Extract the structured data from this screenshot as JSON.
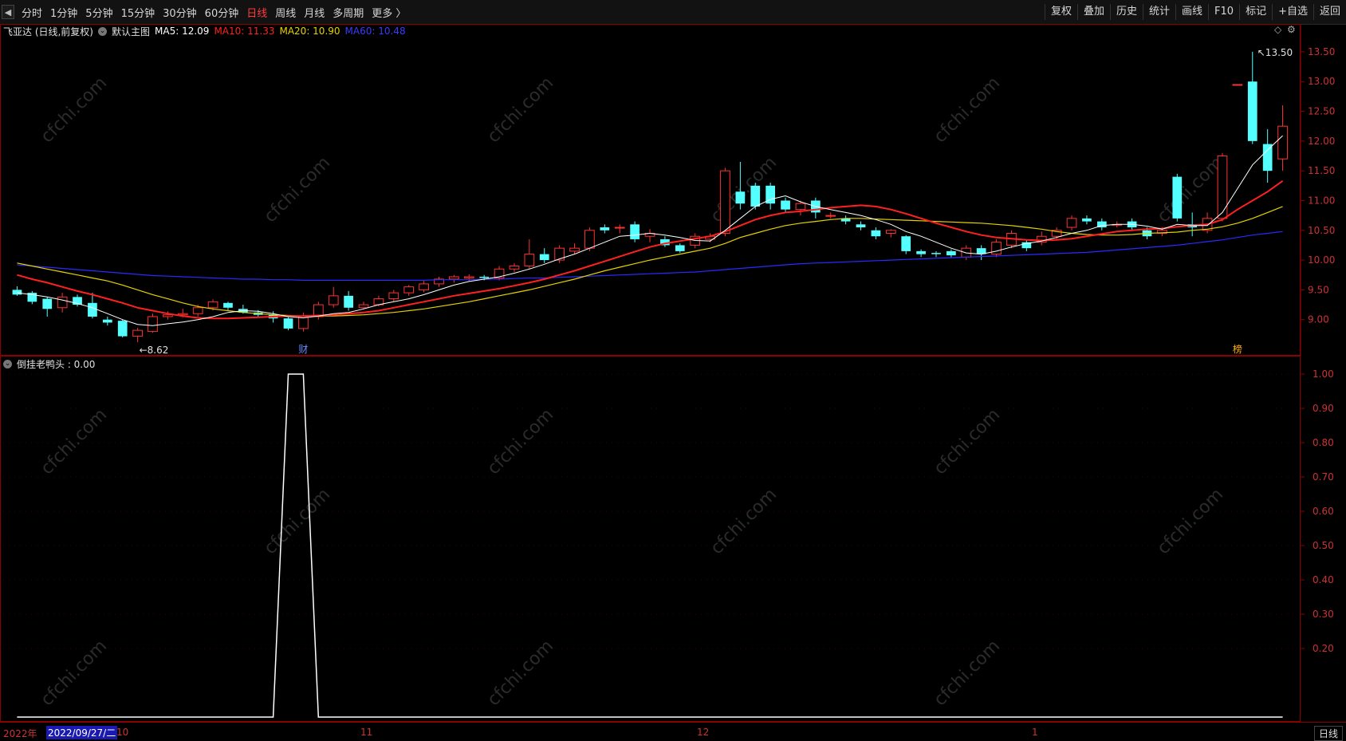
{
  "toolbar": {
    "periods": [
      "分时",
      "1分钟",
      "5分钟",
      "15分钟",
      "30分钟",
      "60分钟",
      "日线",
      "周线",
      "月线",
      "多周期",
      "更多 〉"
    ],
    "active_period": "日线",
    "right_buttons": [
      "复权",
      "叠加",
      "历史",
      "统计",
      "画线",
      "F10",
      "标记",
      "+自选",
      "返回"
    ]
  },
  "main_legend": {
    "title": "飞亚达 (日线,前复权)",
    "template": "默认主图",
    "ma5": "MA5: 12.09",
    "ma10": "MA10: 11.33",
    "ma20": "MA20: 10.90",
    "ma60": "MA60: 10.48",
    "colors": {
      "ma5": "#ffffff",
      "ma10": "#ff2020",
      "ma20": "#e6d200",
      "ma60": "#2a2aff"
    }
  },
  "main_axis_ticks": [
    "13.50",
    "13.00",
    "12.50",
    "12.00",
    "11.50",
    "11.00",
    "10.50",
    "10.00",
    "9.50",
    "9.00"
  ],
  "annotations": {
    "low": "8.62",
    "high": "13.50",
    "fin_marker": "财",
    "list_marker": "榜"
  },
  "sub_legend": {
    "indicator": "倒挂老鸭头 : 0.00"
  },
  "sub_axis_ticks": [
    "1.00",
    "0.90",
    "0.80",
    "0.70",
    "0.60",
    "0.50",
    "0.40",
    "0.30",
    "0.20"
  ],
  "bottom": {
    "year": "2022年",
    "selected_date": "2022/09/27/二",
    "months": [
      "10",
      "11",
      "12",
      "1"
    ],
    "period_tag": "日线"
  },
  "watermark": "cfchi.com",
  "chart_data": {
    "type": "candlestick",
    "ylim": [
      8.5,
      13.7
    ],
    "candles": [
      [
        9.5,
        9.42,
        9.56,
        9.4
      ],
      [
        9.45,
        9.3,
        9.48,
        9.26
      ],
      [
        9.35,
        9.18,
        9.38,
        9.05
      ],
      [
        9.2,
        9.38,
        9.45,
        9.12
      ],
      [
        9.38,
        9.25,
        9.42,
        9.22
      ],
      [
        9.28,
        9.05,
        9.45,
        9.02
      ],
      [
        9.0,
        8.95,
        9.05,
        8.9
      ],
      [
        8.98,
        8.72,
        9.0,
        8.7
      ],
      [
        8.72,
        8.82,
        8.86,
        8.62
      ],
      [
        8.8,
        9.05,
        9.1,
        8.78
      ],
      [
        9.05,
        9.08,
        9.14,
        9.0
      ],
      [
        9.08,
        9.1,
        9.18,
        9.04
      ],
      [
        9.1,
        9.2,
        9.25,
        9.05
      ],
      [
        9.2,
        9.3,
        9.34,
        9.15
      ],
      [
        9.28,
        9.2,
        9.3,
        9.16
      ],
      [
        9.18,
        9.12,
        9.25,
        9.1
      ],
      [
        9.12,
        9.08,
        9.16,
        9.05
      ],
      [
        9.08,
        9.02,
        9.14,
        8.95
      ],
      [
        9.02,
        8.85,
        9.04,
        8.82
      ],
      [
        8.85,
        9.05,
        9.12,
        8.8
      ],
      [
        9.05,
        9.25,
        9.3,
        9.0
      ],
      [
        9.25,
        9.4,
        9.55,
        9.2
      ],
      [
        9.4,
        9.2,
        9.48,
        9.15
      ],
      [
        9.2,
        9.25,
        9.3,
        9.18
      ],
      [
        9.25,
        9.35,
        9.4,
        9.22
      ],
      [
        9.35,
        9.45,
        9.5,
        9.3
      ],
      [
        9.45,
        9.55,
        9.58,
        9.4
      ],
      [
        9.5,
        9.6,
        9.65,
        9.46
      ],
      [
        9.6,
        9.68,
        9.72,
        9.55
      ],
      [
        9.68,
        9.72,
        9.75,
        9.62
      ],
      [
        9.7,
        9.72,
        9.76,
        9.65
      ],
      [
        9.72,
        9.7,
        9.75,
        9.66
      ],
      [
        9.7,
        9.85,
        9.9,
        9.66
      ],
      [
        9.85,
        9.9,
        9.95,
        9.8
      ],
      [
        9.9,
        10.1,
        10.35,
        9.85
      ],
      [
        10.1,
        10.0,
        10.2,
        9.95
      ],
      [
        10.0,
        10.2,
        10.25,
        9.95
      ],
      [
        10.15,
        10.2,
        10.28,
        10.1
      ],
      [
        10.2,
        10.5,
        10.55,
        10.15
      ],
      [
        10.55,
        10.5,
        10.6,
        10.45
      ],
      [
        10.55,
        10.55,
        10.6,
        10.45
      ],
      [
        10.6,
        10.35,
        10.65,
        10.3
      ],
      [
        10.4,
        10.45,
        10.52,
        10.3
      ],
      [
        10.35,
        10.25,
        10.4,
        10.22
      ],
      [
        10.25,
        10.15,
        10.28,
        10.12
      ],
      [
        10.25,
        10.4,
        10.45,
        10.2
      ],
      [
        10.35,
        10.4,
        10.45,
        10.3
      ],
      [
        10.45,
        11.5,
        11.55,
        10.4
      ],
      [
        11.15,
        10.95,
        11.65,
        10.85
      ],
      [
        11.25,
        10.9,
        11.3,
        10.85
      ],
      [
        11.25,
        10.95,
        11.3,
        10.85
      ],
      [
        11.0,
        10.85,
        11.05,
        10.8
      ],
      [
        10.85,
        10.95,
        11.0,
        10.75
      ],
      [
        11.0,
        10.8,
        11.05,
        10.7
      ],
      [
        10.75,
        10.75,
        10.8,
        10.7
      ],
      [
        10.7,
        10.65,
        10.75,
        10.6
      ],
      [
        10.6,
        10.55,
        10.65,
        10.5
      ],
      [
        10.5,
        10.4,
        10.55,
        10.35
      ],
      [
        10.45,
        10.5,
        10.52,
        10.38
      ],
      [
        10.4,
        10.15,
        10.42,
        10.1
      ],
      [
        10.15,
        10.1,
        10.18,
        10.05
      ],
      [
        10.12,
        10.1,
        10.15,
        10.05
      ],
      [
        10.15,
        10.08,
        10.18,
        10.05
      ],
      [
        10.05,
        10.2,
        10.25,
        10.0
      ],
      [
        10.2,
        10.1,
        10.25,
        10.0
      ],
      [
        10.1,
        10.3,
        10.35,
        10.05
      ],
      [
        10.25,
        10.45,
        10.5,
        10.2
      ],
      [
        10.3,
        10.2,
        10.35,
        10.15
      ],
      [
        10.3,
        10.4,
        10.48,
        10.25
      ],
      [
        10.4,
        10.5,
        10.55,
        10.35
      ],
      [
        10.55,
        10.7,
        10.75,
        10.5
      ],
      [
        10.7,
        10.65,
        10.75,
        10.6
      ],
      [
        10.65,
        10.55,
        10.7,
        10.5
      ],
      [
        10.6,
        10.6,
        10.65,
        10.55
      ],
      [
        10.65,
        10.55,
        10.7,
        10.5
      ],
      [
        10.5,
        10.4,
        10.55,
        10.35
      ],
      [
        10.45,
        10.5,
        10.55,
        10.4
      ],
      [
        11.4,
        10.7,
        11.45,
        10.65
      ],
      [
        10.6,
        10.55,
        10.8,
        10.4
      ],
      [
        10.5,
        10.7,
        10.8,
        10.45
      ],
      [
        10.7,
        11.75,
        11.8,
        10.65
      ],
      [
        12.95,
        12.95,
        12.95,
        12.95
      ],
      [
        13.0,
        12.0,
        13.5,
        11.95
      ],
      [
        11.95,
        11.5,
        12.2,
        11.3
      ],
      [
        11.7,
        12.25,
        12.6,
        11.5
      ]
    ],
    "ma5": [
      9.45,
      9.42,
      9.38,
      9.33,
      9.27,
      9.2,
      9.1,
      9.0,
      8.92,
      8.9,
      8.93,
      8.96,
      9.0,
      9.05,
      9.12,
      9.15,
      9.14,
      9.1,
      9.05,
      9.03,
      9.06,
      9.1,
      9.12,
      9.18,
      9.25,
      9.3,
      9.35,
      9.42,
      9.5,
      9.58,
      9.64,
      9.68,
      9.72,
      9.78,
      9.85,
      9.93,
      10.02,
      10.1,
      10.2,
      10.3,
      10.4,
      10.42,
      10.45,
      10.42,
      10.38,
      10.33,
      10.32,
      10.5,
      10.7,
      10.9,
      11.02,
      11.08,
      10.98,
      10.9,
      10.85,
      10.8,
      10.75,
      10.68,
      10.6,
      10.48,
      10.4,
      10.3,
      10.2,
      10.12,
      10.1,
      10.15,
      10.22,
      10.28,
      10.32,
      10.38,
      10.45,
      10.5,
      10.58,
      10.6,
      10.6,
      10.57,
      10.52,
      10.6,
      10.58,
      10.58,
      10.8,
      11.2,
      11.6,
      11.85,
      12.09
    ],
    "ma10": [
      9.75,
      9.68,
      9.62,
      9.55,
      9.48,
      9.42,
      9.35,
      9.28,
      9.2,
      9.15,
      9.1,
      9.06,
      9.03,
      9.02,
      9.02,
      9.03,
      9.04,
      9.05,
      9.06,
      9.06,
      9.07,
      9.08,
      9.1,
      9.12,
      9.15,
      9.2,
      9.25,
      9.3,
      9.35,
      9.4,
      9.44,
      9.48,
      9.52,
      9.57,
      9.62,
      9.68,
      9.75,
      9.82,
      9.9,
      9.98,
      10.06,
      10.14,
      10.22,
      10.28,
      10.32,
      10.36,
      10.4,
      10.48,
      10.58,
      10.68,
      10.75,
      10.8,
      10.82,
      10.85,
      10.88,
      10.9,
      10.92,
      10.9,
      10.85,
      10.78,
      10.7,
      10.62,
      10.55,
      10.48,
      10.42,
      10.38,
      10.36,
      10.34,
      10.33,
      10.34,
      10.36,
      10.4,
      10.44,
      10.48,
      10.5,
      10.52,
      10.53,
      10.56,
      10.58,
      10.6,
      10.68,
      10.85,
      11.0,
      11.15,
      11.33
    ],
    "ma20": [
      9.95,
      9.9,
      9.85,
      9.8,
      9.75,
      9.7,
      9.65,
      9.58,
      9.5,
      9.42,
      9.35,
      9.28,
      9.22,
      9.18,
      9.15,
      9.12,
      9.1,
      9.08,
      9.07,
      9.06,
      9.06,
      9.06,
      9.07,
      9.08,
      9.1,
      9.12,
      9.15,
      9.18,
      9.22,
      9.26,
      9.3,
      9.35,
      9.4,
      9.45,
      9.5,
      9.56,
      9.62,
      9.68,
      9.75,
      9.82,
      9.88,
      9.94,
      10.0,
      10.05,
      10.1,
      10.15,
      10.2,
      10.28,
      10.38,
      10.45,
      10.52,
      10.58,
      10.62,
      10.65,
      10.68,
      10.7,
      10.7,
      10.69,
      10.68,
      10.67,
      10.66,
      10.65,
      10.64,
      10.63,
      10.62,
      10.6,
      10.58,
      10.55,
      10.52,
      10.48,
      10.45,
      10.43,
      10.42,
      10.42,
      10.43,
      10.45,
      10.46,
      10.47,
      10.5,
      10.52,
      10.56,
      10.62,
      10.7,
      10.8,
      10.9
    ],
    "ma60": [
      9.92,
      9.9,
      9.88,
      9.86,
      9.84,
      9.82,
      9.8,
      9.78,
      9.76,
      9.74,
      9.73,
      9.72,
      9.71,
      9.7,
      9.69,
      9.68,
      9.68,
      9.67,
      9.67,
      9.66,
      9.66,
      9.66,
      9.66,
      9.66,
      9.66,
      9.66,
      9.66,
      9.66,
      9.67,
      9.67,
      9.67,
      9.68,
      9.68,
      9.69,
      9.7,
      9.7,
      9.71,
      9.72,
      9.73,
      9.74,
      9.75,
      9.76,
      9.77,
      9.78,
      9.79,
      9.8,
      9.82,
      9.84,
      9.86,
      9.88,
      9.9,
      9.92,
      9.94,
      9.95,
      9.96,
      9.97,
      9.98,
      9.99,
      10.0,
      10.01,
      10.02,
      10.03,
      10.04,
      10.05,
      10.06,
      10.07,
      10.08,
      10.09,
      10.1,
      10.11,
      10.12,
      10.13,
      10.15,
      10.17,
      10.19,
      10.21,
      10.23,
      10.25,
      10.28,
      10.31,
      10.34,
      10.38,
      10.42,
      10.45,
      10.48
    ],
    "indicator": [
      0,
      0,
      0,
      0,
      0,
      0,
      0,
      0,
      0,
      0,
      0,
      0,
      0,
      0,
      0,
      0,
      0,
      0,
      1,
      1,
      0,
      0,
      0,
      0,
      0,
      0,
      0,
      0,
      0,
      0,
      0,
      0,
      0,
      0,
      0,
      0,
      0,
      0,
      0,
      0,
      0,
      0,
      0,
      0,
      0,
      0,
      0,
      0,
      0,
      0,
      0,
      0,
      0,
      0,
      0,
      0,
      0,
      0,
      0,
      0,
      0,
      0,
      0,
      0,
      0,
      0,
      0,
      0,
      0,
      0,
      0,
      0,
      0,
      0,
      0,
      0,
      0,
      0,
      0,
      0,
      0,
      0,
      0,
      0,
      0
    ]
  }
}
